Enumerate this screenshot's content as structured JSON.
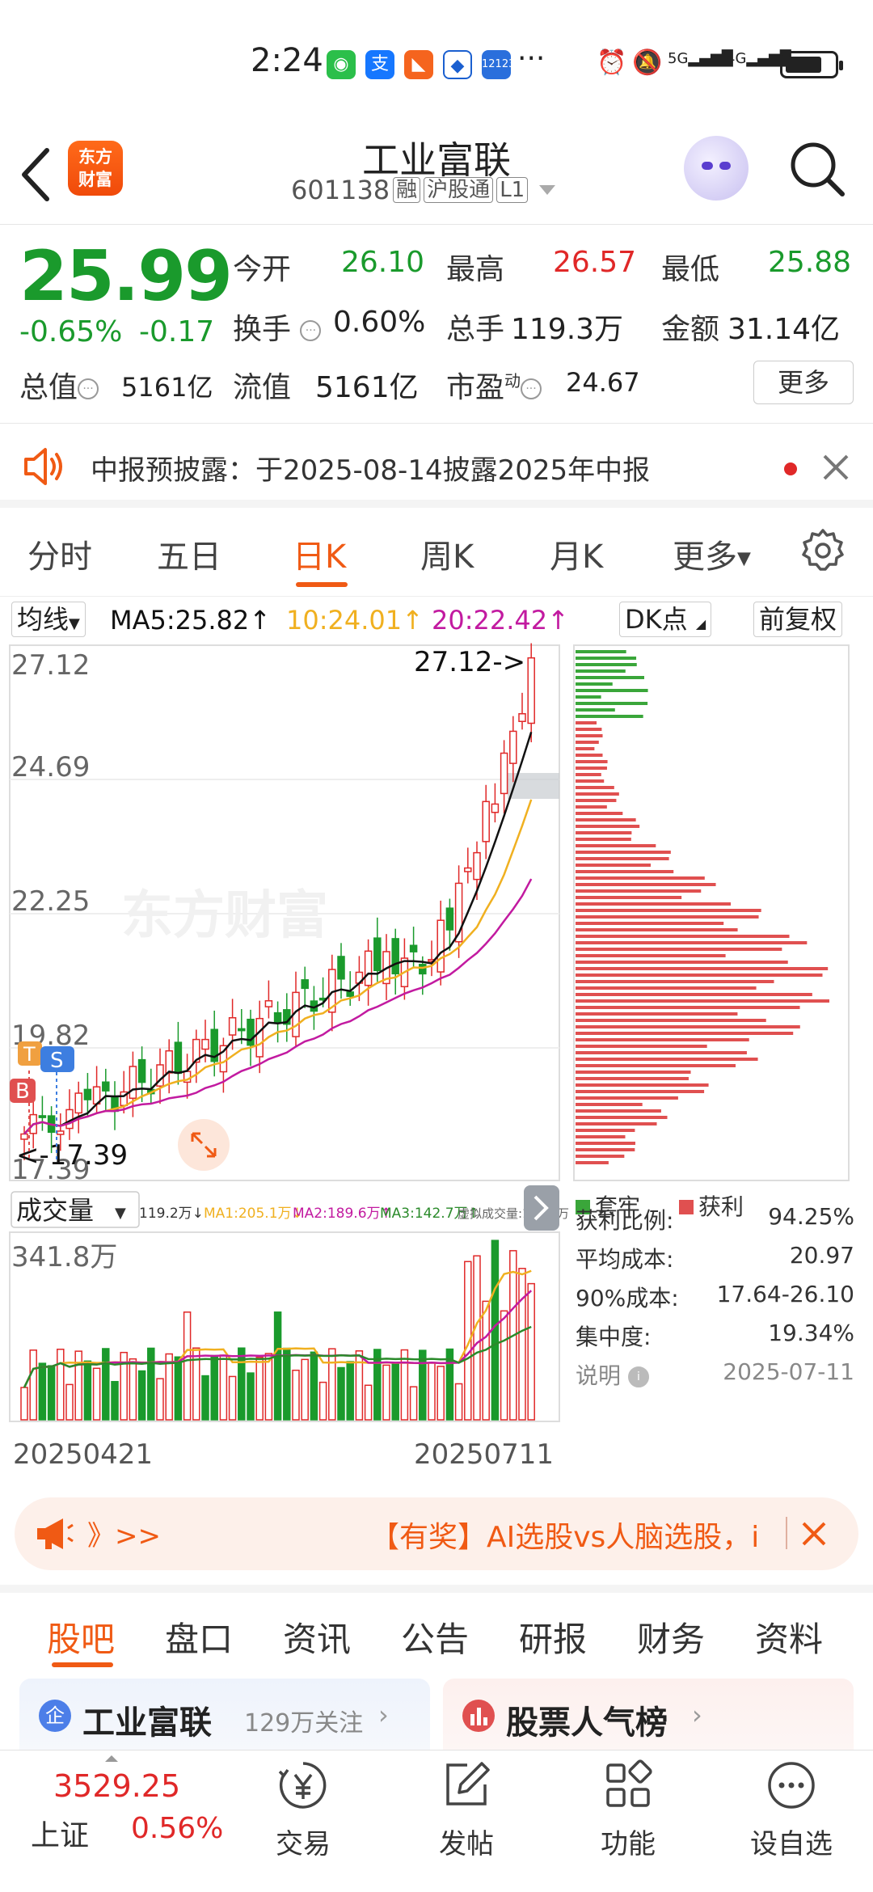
{
  "status_bar": {
    "time": "2:24",
    "more": "···",
    "signal_1": "5G",
    "signal_2": "4G"
  },
  "header": {
    "logo_line1": "东方",
    "logo_line2": "财富",
    "stock_name": "工业富联",
    "stock_code": "601138",
    "tags": [
      "融",
      "沪股通",
      "L1"
    ]
  },
  "quote": {
    "price": "25.99",
    "pct_change": "-0.65%",
    "abs_change": "-0.17",
    "open_label": "今开",
    "open": "26.10",
    "high_label": "最高",
    "high": "26.57",
    "low_label": "最低",
    "low": "25.88",
    "turnover_label": "换手",
    "turnover": "0.60%",
    "volume_label": "总手",
    "volume": "119.3万",
    "amount_label": "金额",
    "amount": "31.14亿",
    "total_value_label": "总值",
    "total_value": "5161亿",
    "float_value_label": "流值",
    "float_value": "5161亿",
    "pe_label": "市盈",
    "pe_sup": "动",
    "pe": "24.67",
    "more_button": "更多"
  },
  "notice": {
    "text": "中报预披露：于2025-08-14披露2025年中报"
  },
  "kline_tabs": [
    "分时",
    "五日",
    "日K",
    "周K",
    "月K",
    "更多"
  ],
  "ma_row": {
    "select": "均线",
    "ma5": "MA5:25.82↑",
    "ma10": "10:24.01↑",
    "ma20": "20:22.42↑",
    "dk": "DK点",
    "adjust": "前复权"
  },
  "colors": {
    "up": "#e02828",
    "down": "#1a9a2c",
    "ma5": "#111111",
    "ma10": "#f0b020",
    "ma20": "#c21aa0",
    "accent": "#f05a14"
  },
  "price_axis": {
    "ticks": [
      "27.12",
      "24.69",
      "22.25",
      "19.82",
      "17.39"
    ],
    "max_marker": "27.12->",
    "min_marker": "<-17.39"
  },
  "volume_panel": {
    "select": "成交量",
    "legend": [
      "119.2万↓",
      "MA1:205.1万↓",
      "MA2:189.6万↑",
      "MA3:142.7万↑",
      "虚拟成交量:145.5万"
    ],
    "max_label": "341.8万",
    "start_date": "20250421",
    "end_date": "20250711"
  },
  "markers": {
    "t": "T",
    "s": "S",
    "b": "B"
  },
  "chip": {
    "legend_trapped": "套牢",
    "legend_profit": "获利",
    "stats": [
      {
        "label": "获利比例:",
        "value": "94.25%"
      },
      {
        "label": "平均成本:",
        "value": "20.97"
      },
      {
        "label": "90%成本:",
        "value": "17.64-26.10"
      },
      {
        "label": "集中度:",
        "value": "19.34%"
      }
    ],
    "note_label": "说明",
    "date": "2025-07-11"
  },
  "watermark": "东方财富",
  "promo": {
    "left": "》>>",
    "text": "【有奖】AI选股vs人脑选股，i"
  },
  "bottom_tabs": [
    "股吧",
    "盘口",
    "资讯",
    "公告",
    "研报",
    "财务",
    "资料"
  ],
  "cards": {
    "left_title": "工业富联",
    "left_sub": "129万关注",
    "right_title": "股票人气榜"
  },
  "bottom_nav": {
    "index_value": "3529.25",
    "index_name": "上证",
    "index_change": "0.56%",
    "items": [
      "交易",
      "发帖",
      "功能",
      "设自选"
    ]
  }
}
